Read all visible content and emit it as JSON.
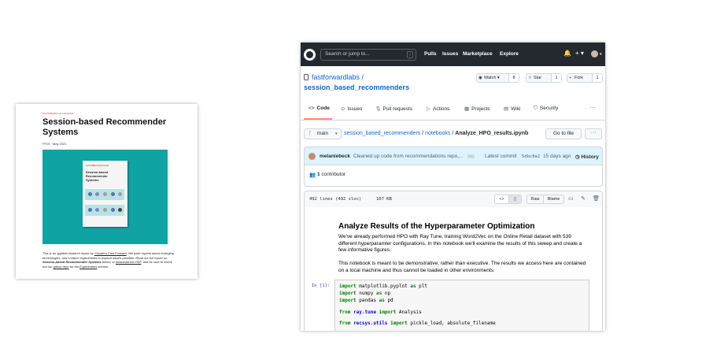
{
  "report": {
    "brand": "CLOUDERA Fast Forward",
    "title": "Session-based Recommender Systems",
    "date": "FF19 · May 2021",
    "book_brand": "CLOUDERA Fast Forward",
    "book_title": "Session-based Recommender Systems",
    "desc_1": "This is an applied research report by ",
    "desc_link_1": "Cloudera Fast Forward",
    "desc_2": ". We write reports about emerging technologies, and conduct experiments to explore what's possible. Read our full report on ",
    "desc_bold": "Session-based Recommender Systems",
    "desc_3": " below, or ",
    "desc_link_2": "download the PDF",
    "desc_4": ", and be sure to check out our ",
    "desc_link_3": "github repo",
    "desc_5": " for the ",
    "desc_link_4": "Experiments",
    "desc_6": " section."
  },
  "topbar": {
    "search_placeholder": "Search or jump to...",
    "search_key": "/",
    "nav": [
      "Pulls",
      "Issues",
      "Marketplace",
      "Explore"
    ],
    "bell": "🔔",
    "plus": "+ ▾",
    "avatar_caret": "▾"
  },
  "repo": {
    "owner": "fastforwardlabs /",
    "name": "session_based_recommenders",
    "watch_label": "Watch ▾",
    "watch_count": "8",
    "star_label": "Star",
    "star_count": "1",
    "fork_label": "Fork",
    "fork_count": "1"
  },
  "tabs": [
    {
      "icon": "<>",
      "label": "Code"
    },
    {
      "icon": "⊙",
      "label": "Issues"
    },
    {
      "icon": "⇅",
      "label": "Pull requests"
    },
    {
      "icon": "▷",
      "label": "Actions"
    },
    {
      "icon": "▦",
      "label": "Projects"
    },
    {
      "icon": "▤",
      "label": "Wiki"
    },
    {
      "icon": "⛉",
      "label": "Security"
    }
  ],
  "tabs_more": "···",
  "path": {
    "branch": "main",
    "repo_link": "session_based_recommenders",
    "sep1": " / ",
    "folder_link": "notebooks",
    "sep2": " / ",
    "file": "Analyze_HPO_results.ipynb",
    "goto_label": "Go to file",
    "more": "···"
  },
  "commit": {
    "author": "melaniebeck",
    "message": "Cleaned up code from recommendations repo,...",
    "ellipsis": "…",
    "latest": "Latest commit",
    "sha": "5dbc8a2",
    "ago": "15 days ago",
    "history": "History",
    "history_icon": "◷",
    "contributors_icon": "👥",
    "contributors_count": "1",
    "contributors_label": " contributor"
  },
  "file": {
    "lines": "492 lines (492 sloc)",
    "size": "107 KB",
    "raw": "Raw",
    "blame": "Blame",
    "code_icon": "<>",
    "doc_icon": "▯",
    "monitor_icon": "▭",
    "pencil_icon": "✎",
    "trash_icon": "🗑"
  },
  "notebook": {
    "heading": "Analyze Results of the Hyperparameter Optimization",
    "para1": "We've already performed HPO with Ray Tune, training Word2Vec on the Online Retail dataset with 539 different hyperparamter configurations. In this notebook we'll examine the results of this sweep and create a few informative figures.",
    "para2": "This notebook is meant to be demonstrative, rather than executive. The results we access here are contained on a local machine and thus cannot be loaded in other environments.",
    "prompt": "In [1]:",
    "code": [
      {
        "kw": "import",
        "mod": " matplotlib.pyplot ",
        "as": "as",
        "alias": " plt"
      },
      {
        "kw": "import",
        "mod": " numpy ",
        "as": "as",
        "alias": " np"
      },
      {
        "kw": "import",
        "mod": " pandas ",
        "as": "as",
        "alias": " pd"
      },
      {
        "kw": "from",
        "mod": " ray.tune ",
        "as": "import",
        "alias": " Analysis"
      },
      {
        "kw": "from",
        "mod": " recsys.utils ",
        "as": "import",
        "alias": " pickle_load, absolute_filename"
      }
    ]
  }
}
